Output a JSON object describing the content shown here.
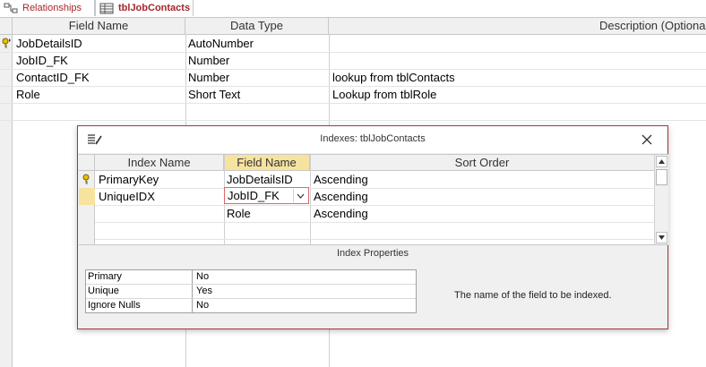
{
  "tabs": [
    {
      "label": "Relationships",
      "icon": "relationships-icon"
    },
    {
      "label": "tblJobContacts",
      "icon": "table-icon"
    }
  ],
  "design_grid": {
    "columns": {
      "field_name": "Field Name",
      "data_type": "Data Type",
      "description": "Description (Optional)"
    },
    "rows": [
      {
        "field": "JobDetailsID",
        "type": "AutoNumber",
        "desc": "",
        "primary_key": true
      },
      {
        "field": "JobID_FK",
        "type": "Number",
        "desc": ""
      },
      {
        "field": "ContactID_FK",
        "type": "Number",
        "desc": "lookup from tblContacts"
      },
      {
        "field": "Role",
        "type": "Short Text",
        "desc": "Lookup from tblRole"
      }
    ]
  },
  "indexes_dialog": {
    "title": "Indexes: tblJobContacts",
    "columns": {
      "index_name": "Index Name",
      "field_name": "Field Name",
      "sort_order": "Sort Order"
    },
    "rows": [
      {
        "index": "PrimaryKey",
        "field": "JobDetailsID",
        "sort": "Ascending",
        "primary_key": true
      },
      {
        "index": "UniqueIDX",
        "field": "JobID_FK",
        "sort": "Ascending"
      },
      {
        "index": "",
        "field": "Role",
        "sort": "Ascending"
      }
    ],
    "properties_title": "Index Properties",
    "properties": [
      {
        "name": "Primary",
        "value": "No"
      },
      {
        "name": "Unique",
        "value": "Yes"
      },
      {
        "name": "Ignore Nulls",
        "value": "No"
      }
    ],
    "help_text": "The name of the field to be indexed."
  },
  "colors": {
    "accent": "#a4262c",
    "selected": "#f7e3a0",
    "dialog_border": "#9e3a3a"
  }
}
